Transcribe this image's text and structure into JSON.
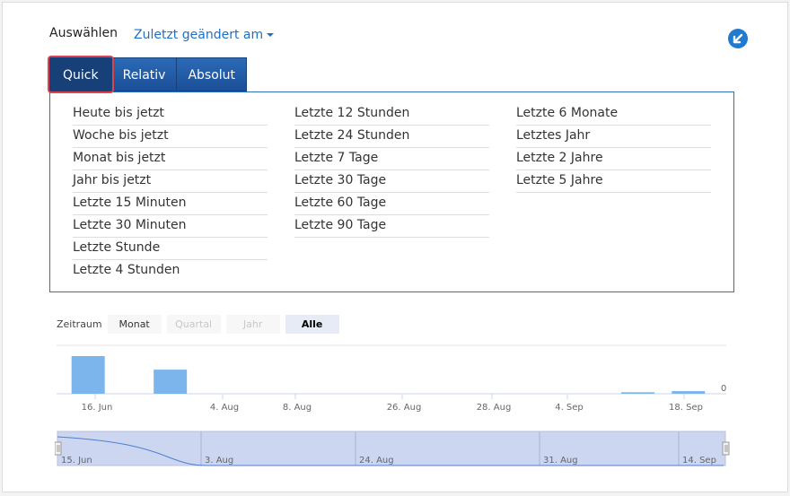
{
  "header": {
    "select_label": "Auswählen",
    "sort_label": "Zuletzt geändert am",
    "collapse_icon": "arrow-down-left-icon",
    "accent": "#1f7ad0"
  },
  "tabs": [
    {
      "label": "Quick",
      "active": true
    },
    {
      "label": "Relativ",
      "active": false
    },
    {
      "label": "Absolut",
      "active": false
    }
  ],
  "quick": {
    "col1": [
      "Heute bis jetzt",
      "Woche bis jetzt",
      "Monat bis jetzt",
      "Jahr bis jetzt",
      "Letzte 15 Minuten",
      "Letzte 30 Minuten",
      "Letzte Stunde",
      "Letzte 4 Stunden"
    ],
    "col2": [
      "Letzte 12 Stunden",
      "Letzte 24 Stunden",
      "Letzte 7 Tage",
      "Letzte 30 Tage",
      "Letzte 60 Tage",
      "Letzte 90 Tage"
    ],
    "col3": [
      "Letzte 6 Monate",
      "Letztes Jahr",
      "Letzte 2 Jahre",
      "Letzte 5 Jahre"
    ]
  },
  "zoom": {
    "label": "Zeitraum",
    "buttons": [
      {
        "label": "Monat",
        "state": "normal"
      },
      {
        "label": "Quartal",
        "state": "disabled"
      },
      {
        "label": "Jahr",
        "state": "disabled"
      },
      {
        "label": "Alle",
        "state": "selected"
      }
    ]
  },
  "chart_data": {
    "type": "bar",
    "x_ticks": [
      "16. Jun",
      "4. Aug",
      "8. Aug",
      "26. Aug",
      "28. Aug",
      "4. Sep",
      "18. Sep"
    ],
    "y_ticks": [
      "0"
    ],
    "bars": [
      {
        "date": "2019-06-16",
        "value": 1.0
      },
      {
        "date": "2019-06-29",
        "value": 0.64
      },
      {
        "date": "2019-09-11",
        "value": 0.04
      },
      {
        "date": "2019-09-19",
        "value": 0.07
      }
    ],
    "bar_color": "#7cb5ec",
    "navigator": {
      "ticks": [
        "15. Jun",
        "3. Aug",
        "24. Aug",
        "31. Aug",
        "14. Sep"
      ]
    }
  }
}
